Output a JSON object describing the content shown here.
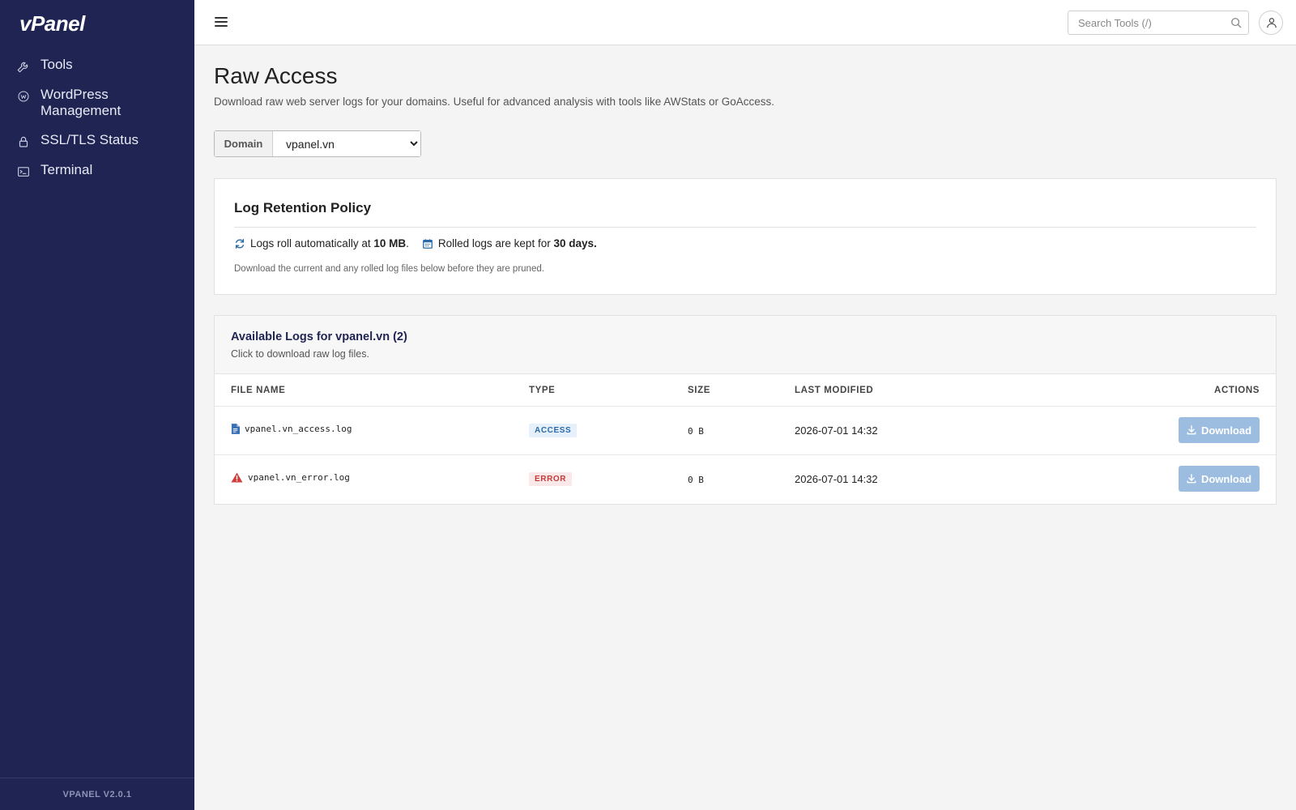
{
  "app": {
    "logo": "vPanel",
    "version": "VPANEL V2.0.1"
  },
  "sidebar": {
    "items": [
      {
        "label": "Tools",
        "icon": "wrench-icon"
      },
      {
        "label": "WordPress Management",
        "icon": "wordpress-icon"
      },
      {
        "label": "SSL/TLS Status",
        "icon": "lock-icon"
      },
      {
        "label": "Terminal",
        "icon": "terminal-icon"
      }
    ]
  },
  "header": {
    "search_placeholder": "Search Tools (/)"
  },
  "page": {
    "title": "Raw Access",
    "description": "Download raw web server logs for your domains. Useful for advanced analysis with tools like AWStats or GoAccess."
  },
  "domain": {
    "label": "Domain",
    "selected": "vpanel.vn",
    "options": [
      "vpanel.vn"
    ]
  },
  "policy": {
    "title": "Log Retention Policy",
    "roll_prefix": "Logs roll automatically at",
    "roll_size": "10 MB",
    "roll_suffix": ".",
    "keep_prefix": "Rolled logs are kept for",
    "keep_days": "30 days.",
    "note": "Download the current and any rolled log files below before they are pruned."
  },
  "logs": {
    "title": "Available Logs for vpanel.vn (2)",
    "subtitle": "Click to download raw log files.",
    "columns": {
      "file_name": "FILE NAME",
      "type": "TYPE",
      "size": "SIZE",
      "last_modified": "LAST MODIFIED",
      "actions": "ACTIONS"
    },
    "rows": [
      {
        "file": "vpanel.vn_access.log",
        "type": "ACCESS",
        "size": "0 B",
        "modified": "2026-07-01 14:32",
        "action": "Download",
        "icon": "file-icon"
      },
      {
        "file": "vpanel.vn_error.log",
        "type": "ERROR",
        "size": "0 B",
        "modified": "2026-07-01 14:32",
        "action": "Download",
        "icon": "warning-icon"
      }
    ]
  },
  "colors": {
    "sidebar_bg": "#1f2453",
    "accent": "#2b6aa8",
    "download_btn": "#9cbde0",
    "error": "#c23b3b"
  }
}
